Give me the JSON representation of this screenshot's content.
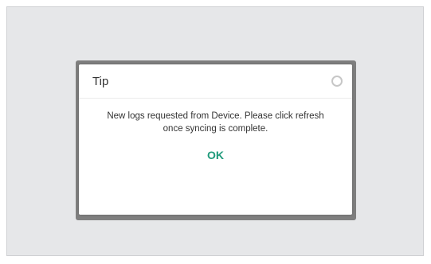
{
  "dialog": {
    "title": "Tip",
    "close_icon": "close-circle-icon",
    "message": "New logs requested from Device. Please click refresh once syncing is complete.",
    "ok_label": "OK"
  },
  "colors": {
    "screen_background": "#e6e7e9",
    "overlay_frame": "#7f7f7f",
    "dialog_background": "#ffffff",
    "ok_accent": "#1f9a7b"
  }
}
